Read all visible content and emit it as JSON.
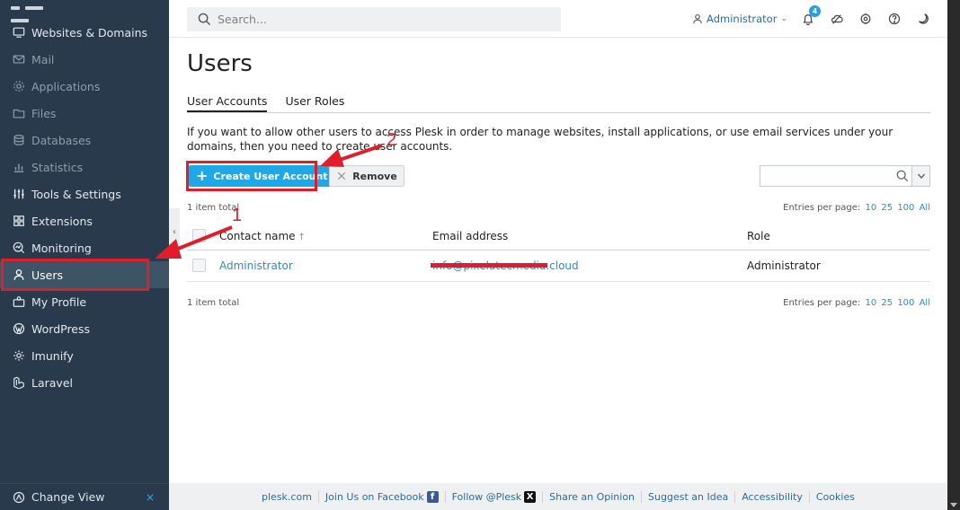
{
  "sidebar": {
    "items": [
      {
        "label": "Websites & Domains",
        "icon": "monitor-icon",
        "dim": false
      },
      {
        "label": "Mail",
        "icon": "mail-icon",
        "dim": true
      },
      {
        "label": "Applications",
        "icon": "gear-icon",
        "dim": true
      },
      {
        "label": "Files",
        "icon": "folder-icon",
        "dim": true
      },
      {
        "label": "Databases",
        "icon": "database-icon",
        "dim": true
      },
      {
        "label": "Statistics",
        "icon": "bar-chart-icon",
        "dim": true
      },
      {
        "label": "Tools & Settings",
        "icon": "sliders-icon",
        "dim": false
      },
      {
        "label": "Extensions",
        "icon": "extensions-icon",
        "dim": false
      },
      {
        "label": "Monitoring",
        "icon": "monitoring-icon",
        "dim": false
      },
      {
        "label": "Users",
        "icon": "user-icon",
        "dim": false
      },
      {
        "label": "My Profile",
        "icon": "profile-icon",
        "dim": false
      },
      {
        "label": "WordPress",
        "icon": "wordpress-icon",
        "dim": false
      },
      {
        "label": "Imunify",
        "icon": "shield-gear-icon",
        "dim": false
      },
      {
        "label": "Laravel",
        "icon": "laravel-icon",
        "dim": false
      }
    ],
    "active": "Users",
    "change_view": "Change View",
    "change_view_close": "×",
    "collapse": "‹"
  },
  "topbar": {
    "search_placeholder": "Search...",
    "user": "Administrator",
    "notifications_count": "4"
  },
  "page": {
    "title": "Users",
    "tabs": [
      "User Accounts",
      "User Roles"
    ],
    "active_tab": "User Accounts",
    "intro": "If you want to allow other users to access Plesk in order to manage websites, install applications, or use email services under your domains, then you need to create user accounts.",
    "create_button": "Create User Account",
    "remove_button": "Remove",
    "items_total": "1 item total",
    "entries_label": "Entries per page:",
    "entries_options": [
      "10",
      "25",
      "100",
      "All"
    ]
  },
  "table": {
    "columns": [
      "Contact name",
      "Email address",
      "Role"
    ],
    "sort_indicator": "↑",
    "rows": [
      {
        "name": "Administrator",
        "email": "info@pixelatecmedia.cloud",
        "role": "Administrator"
      }
    ]
  },
  "annotations": {
    "step1": "1",
    "step2": "2",
    "color": "#e21d2b"
  },
  "footer": {
    "links": [
      "plesk.com",
      "Join Us on Facebook",
      "Follow @Plesk",
      "Share an Opinion",
      "Suggest an Idea",
      "Accessibility",
      "Cookies"
    ]
  },
  "colors": {
    "sidebar_bg": "#283a4b",
    "accent": "#1ea8e6",
    "link": "#2b8ad0"
  }
}
